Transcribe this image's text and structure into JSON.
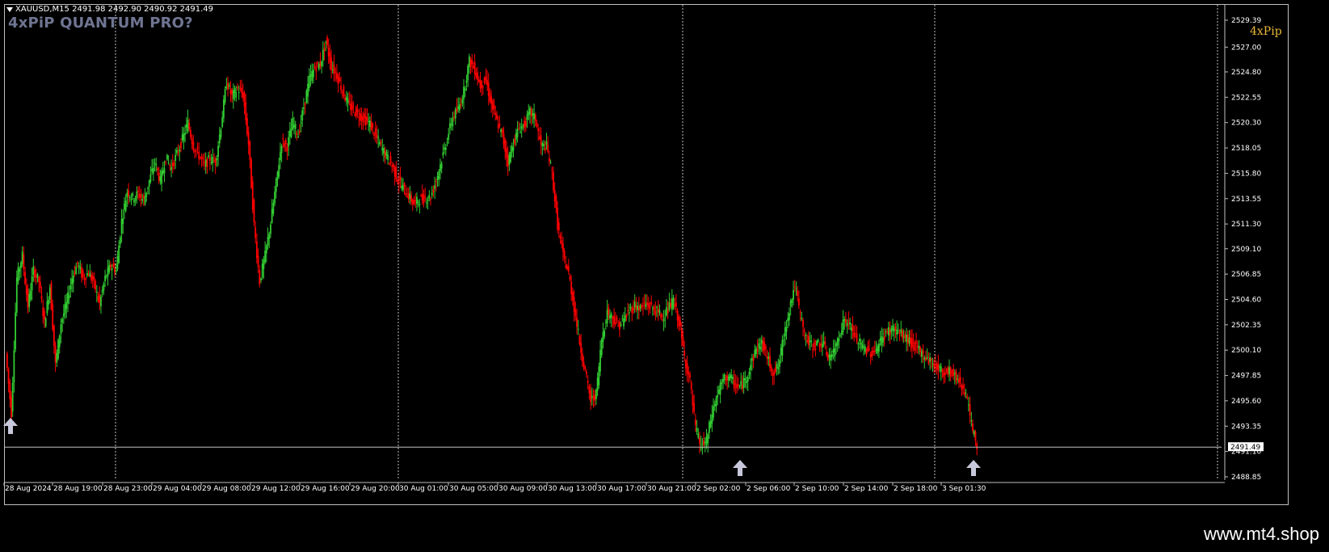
{
  "window": {
    "symbol_line": "XAUUSD,M15  2491.98 2492.90 2490.92 2491.49",
    "brand_title": "4xPiP QUANTUM PRO?",
    "brand_tag": "4xPip",
    "watermark": "www.mt4.shop"
  },
  "colors": {
    "background": "#000000",
    "bull": "#32cd32",
    "bear": "#ff0000",
    "grid": "#ffffff",
    "axis_text": "#ffffff",
    "arrow": "#c8c8dc",
    "brand": "#6f7591",
    "tag": "#e8b83a"
  },
  "icons": {
    "buy_arrow": "up-arrow-icon",
    "menu": "triangle-down-icon"
  },
  "chart_data": {
    "type": "candlestick",
    "symbol": "XAUUSD",
    "timeframe": "M15",
    "ylim": [
      2488.85,
      2529.39
    ],
    "price_ticks": [
      "2529.39",
      "2527.00",
      "2524.80",
      "2522.55",
      "2520.30",
      "2518.05",
      "2515.80",
      "2513.55",
      "2511.30",
      "2509.10",
      "2506.85",
      "2504.60",
      "2502.35",
      "2500.10",
      "2497.85",
      "2495.60",
      "2493.35",
      "2491.10",
      "2488.85"
    ],
    "current_price": "2491.49",
    "time_labels": [
      "28 Aug 2024",
      "28 Aug 19:00",
      "28 Aug 23:00",
      "29 Aug 04:00",
      "29 Aug 08:00",
      "29 Aug 12:00",
      "29 Aug 16:00",
      "29 Aug 20:00",
      "30 Aug 01:00",
      "30 Aug 05:00",
      "30 Aug 09:00",
      "30 Aug 13:00",
      "30 Aug 17:00",
      "30 Aug 21:00",
      "2 Sep 02:00",
      "2 Sep 06:00",
      "2 Sep 10:00",
      "2 Sep 14:00",
      "2 Sep 18:00",
      "3 Sep 01:30"
    ],
    "session_separators": [
      "28 Aug 23:00",
      "29 Aug 20:00",
      "30 Aug 21:00",
      "2 Sep 18:00"
    ],
    "path": [
      2499.8,
      2494.5,
      2506.5,
      2508.5,
      2504,
      2507.2,
      2506.2,
      2502.5,
      2505.8,
      2498.8,
      2502.5,
      2504.2,
      2506.5,
      2507.8,
      2506.5,
      2507,
      2506,
      2504.2,
      2506.5,
      2507.6,
      2507.2,
      2511.6,
      2514.2,
      2513.6,
      2514,
      2513.4,
      2515.1,
      2516.8,
      2515.1,
      2517.2,
      2516.3,
      2517.5,
      2518.8,
      2520.3,
      2518.2,
      2517.4,
      2516.5,
      2517.1,
      2516.8,
      2520,
      2523.9,
      2522.6,
      2523.3,
      2522.8,
      2518.4,
      2511.2,
      2506.2,
      2508.5,
      2511.4,
      2514.9,
      2518.6,
      2518.2,
      2520.3,
      2519.2,
      2521.7,
      2524.1,
      2525.2,
      2525.5,
      2527.5,
      2525.3,
      2524.5,
      2523.1,
      2522,
      2521.4,
      2521,
      2520.6,
      2520.2,
      2519.1,
      2518.2,
      2517.3,
      2516.5,
      2515.3,
      2514.5,
      2513.8,
      2513.1,
      2513.5,
      2513.6,
      2513.7,
      2515.2,
      2517,
      2518.9,
      2520.8,
      2521.5,
      2523.1,
      2525.8,
      2525,
      2523.6,
      2524.1,
      2521.9,
      2520.4,
      2519.1,
      2516.8,
      2518.5,
      2519.8,
      2520.1,
      2521.2,
      2520.6,
      2518.2,
      2518.2,
      2515.8,
      2511.2,
      2508.5,
      2506.9,
      2503.9,
      2500.8,
      2498.2,
      2495.6,
      2496.2,
      2501.1,
      2503.5,
      2503,
      2502.2,
      2502.8,
      2503.6,
      2504.1,
      2503.8,
      2504.2,
      2503.9,
      2503.5,
      2503.1,
      2503.7,
      2504.5,
      2502.6,
      2499.5,
      2497.3,
      2493.2,
      2491.5,
      2492,
      2494.5,
      2496.2,
      2497.4,
      2497.8,
      2497.1,
      2496.8,
      2497.4,
      2498.8,
      2500.2,
      2500.7,
      2499.5,
      2498.1,
      2498.6,
      2501.3,
      2503.8,
      2505.9,
      2503.2,
      2501.1,
      2500.5,
      2500.6,
      2500.8,
      2499.5,
      2499.8,
      2501.5,
      2502.8,
      2502.3,
      2501.2,
      2500.5,
      2500.1,
      2499.8,
      2500.4,
      2501.3,
      2501.8,
      2502,
      2501.6,
      2501.2,
      2500.8,
      2500.3,
      2499.8,
      2499.4,
      2498.9,
      2498.5,
      2498.1,
      2498.3,
      2497.8,
      2497.2,
      2496.3,
      2493.5,
      2491.49
    ],
    "buy_signals": [
      "28 Aug 2024",
      "2 Sep 02:00",
      "3 Sep 01:30"
    ]
  }
}
